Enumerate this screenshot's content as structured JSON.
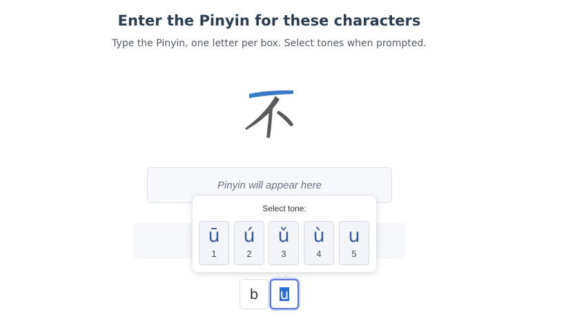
{
  "header": {
    "title": "Enter the Pinyin for these characters",
    "subtitle": "Type the Pinyin, one letter per box. Select tones when prompted."
  },
  "character": {
    "glyph": "不",
    "icon": "stroke-order-character"
  },
  "pinyin_display": {
    "placeholder": "Pinyin will appear here"
  },
  "tone_popup": {
    "label": "Select tone:",
    "tones": [
      {
        "mark": "ū",
        "number": "1"
      },
      {
        "mark": "ú",
        "number": "2"
      },
      {
        "mark": "ǔ",
        "number": "3"
      },
      {
        "mark": "ù",
        "number": "4"
      },
      {
        "mark": "u",
        "number": "5"
      }
    ]
  },
  "letter_boxes": [
    {
      "value": "b"
    },
    {
      "value": "u",
      "selected": true
    }
  ],
  "colors": {
    "accent_stroke": "#3a7bc8",
    "character": "#5a5a5a",
    "tone_text": "#3a5a96",
    "focus_border": "#5b74d3",
    "selection": "#2f6fd6"
  }
}
